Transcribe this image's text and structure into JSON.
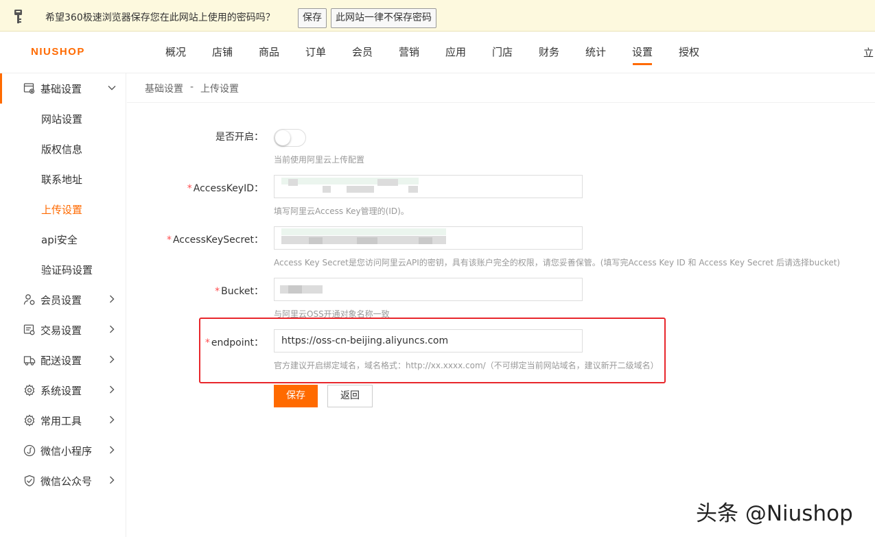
{
  "password_bar": {
    "message": "希望360极速浏览器保存您在此网站上使用的密码吗？",
    "save_label": "保存",
    "never_label": "此网站一律不保存密码"
  },
  "header": {
    "logo": "NIUSHOP",
    "nav": [
      "概况",
      "店铺",
      "商品",
      "订单",
      "会员",
      "营销",
      "应用",
      "门店",
      "财务",
      "统计",
      "设置",
      "授权"
    ],
    "active_nav": "设置",
    "right_text": "立"
  },
  "sidebar": {
    "open_group": {
      "label": "基础设置",
      "icon": "settings-doc-icon"
    },
    "sub_items": [
      "网站设置",
      "版权信息",
      "联系地址",
      "上传设置",
      "api安全",
      "验证码设置"
    ],
    "active_sub": "上传设置",
    "groups": [
      {
        "label": "会员设置",
        "icon": "user-gear-icon"
      },
      {
        "label": "交易设置",
        "icon": "trade-icon"
      },
      {
        "label": "配送设置",
        "icon": "truck-icon"
      },
      {
        "label": "系统设置",
        "icon": "gear-icon"
      },
      {
        "label": "常用工具",
        "icon": "tool-gear-icon"
      },
      {
        "label": "微信小程序",
        "icon": "mini-program-icon"
      },
      {
        "label": "微信公众号",
        "icon": "shield-check-icon"
      }
    ]
  },
  "breadcrumb": {
    "parent": "基础设置",
    "separator": "-",
    "current": "上传设置"
  },
  "form": {
    "enable": {
      "label": "是否开启：",
      "hint": "当前使用阿里云上传配置",
      "enabled": false
    },
    "access_key_id": {
      "label": "AccessKeyID：",
      "hint": "填写阿里云Access Key管理的(ID)。"
    },
    "access_key_secret": {
      "label": "AccessKeySecret：",
      "hint": "Access Key Secret是您访问阿里云API的密钥，具有该账户完全的权限，请您妥善保管。(填写完Access Key ID 和 Access Key Secret 后请选择bucket)"
    },
    "bucket": {
      "label": "Bucket：",
      "hint": "与阿里云OSS开通对象名称一致"
    },
    "endpoint": {
      "label": "endpoint：",
      "value": "https://oss-cn-beijing.aliyuncs.com",
      "hint": "官方建议开启绑定域名，域名格式：http://xx.xxxx.com/（不可绑定当前网站域名，建议新开二级域名）"
    },
    "required_mark": "*",
    "save_label": "保存",
    "back_label": "返回"
  },
  "watermark": "头条 @Niushop",
  "colors": {
    "accent": "#ff6a00",
    "highlight": "#e8262b"
  }
}
